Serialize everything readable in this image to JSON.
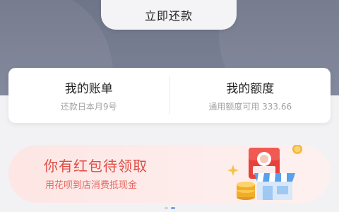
{
  "hero": {
    "repay_button_label": "立即还款"
  },
  "summary": {
    "bill": {
      "title": "我的账单",
      "subtitle": "还款日本月9号"
    },
    "quota": {
      "title": "我的额度",
      "subtitle": "通用额度可用 333.66"
    }
  },
  "banner": {
    "title": "你有红包待领取",
    "subtitle": "用花呗到店消费抵现金",
    "icons": [
      "red-envelope-icon",
      "store-icon",
      "coin-icon"
    ]
  },
  "carousel": {
    "pages": 2,
    "active_index": 1
  },
  "colors": {
    "hero_bg": "#727890",
    "banner_accent": "#e04d45",
    "subtitle_gray": "#a3a3a3"
  }
}
